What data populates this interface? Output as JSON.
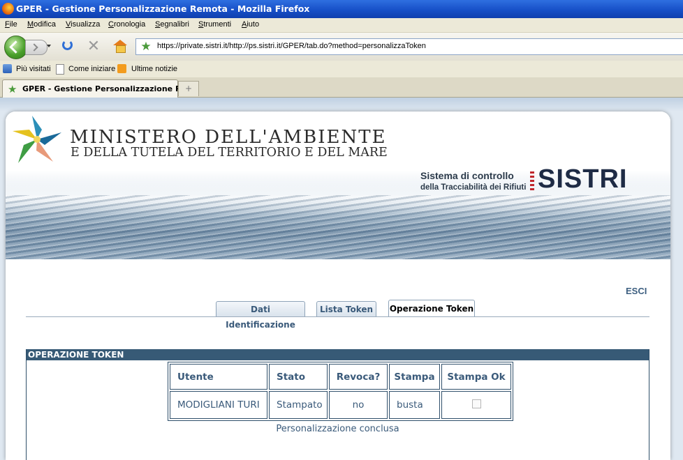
{
  "window": {
    "title": "GPER - Gestione Personalizzazione Remota - Mozilla Firefox"
  },
  "menu": [
    "File",
    "Modifica",
    "Visualizza",
    "Cronologia",
    "Segnalibri",
    "Strumenti",
    "Aiuto"
  ],
  "toolbar": {
    "url": "https://private.sistri.it/http://ps.sistri.it/GPER/tab.do?method=personalizzaToken"
  },
  "bookmarks": [
    {
      "label": "Più visitati",
      "icon": "most-visited-icon"
    },
    {
      "label": "Come iniziare",
      "icon": "page-icon"
    },
    {
      "label": "Ultime notizie",
      "icon": "rss-feed-icon"
    }
  ],
  "browser_tab": {
    "label": "GPER - Gestione Personalizzazione R...",
    "newtab": "+"
  },
  "header": {
    "ministry_line1": "MINISTERO DELL'AMBIENTE",
    "ministry_line2": "E DELLA TUTELA DEL TERRITORIO E DEL MARE",
    "sistri_line1": "Sistema di controllo",
    "sistri_line2": "della Tracciabilità dei Rifiuti",
    "sistri_logo": "SISTRI"
  },
  "page": {
    "logout": "ESCI",
    "tabs": [
      "Dati Identificazione",
      "Lista Token",
      "Operazione Token"
    ],
    "active_tab": "Operazione Token"
  },
  "section": {
    "title": "OPERAZIONE TOKEN",
    "columns": [
      "Utente",
      "Stato",
      "Revoca?",
      "Stampa",
      "Stampa Ok"
    ],
    "row": {
      "utente": "MODIGLIANI TURI",
      "stato": "Stampato",
      "revoca": "no",
      "stampa": "busta",
      "stampa_ok": false
    },
    "status": "Personalizzazione conclusa"
  }
}
